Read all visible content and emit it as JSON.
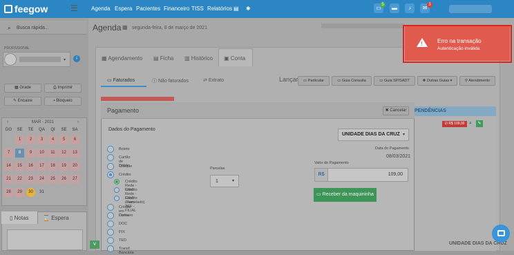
{
  "header": {
    "brand": "feegow",
    "nav": [
      "Agenda",
      "Espera",
      "Pacientes",
      "Financeiro",
      "TISS",
      "Relatórios"
    ],
    "badges": {
      "first": "5",
      "last": "3"
    }
  },
  "sidebar": {
    "search_placeholder": "Busca rápida...",
    "professional_label": "PROFISSIONAL",
    "buttons": [
      "Grade",
      "Imprimir",
      "Encaixe",
      "Bloqueio"
    ],
    "calendar": {
      "month": "MAR - 2021",
      "weekdays": [
        "DO",
        "SE",
        "TE",
        "QA",
        "QI",
        "SE",
        "SA"
      ],
      "days": [
        [
          "",
          "1",
          "2",
          "3",
          "4",
          "5",
          "6"
        ],
        [
          "7",
          "8",
          "9",
          "10",
          "11",
          "12",
          "13"
        ],
        [
          "14",
          "15",
          "16",
          "17",
          "18",
          "19",
          "20"
        ],
        [
          "21",
          "22",
          "23",
          "24",
          "25",
          "26",
          "27"
        ],
        [
          "28",
          "29",
          "30",
          "31",
          "",
          "",
          ""
        ]
      ]
    },
    "notes_tabs": [
      "Notas",
      "Espera"
    ]
  },
  "breadcrumb": {
    "title": "Agenda",
    "date": "segunda-feira, 8 de março de 2021"
  },
  "tabs": [
    "Agendamento",
    "Ficha",
    "Histórico",
    "Conta"
  ],
  "subtabs": [
    "Faturados",
    "Não faturados",
    "Extrato"
  ],
  "launch": {
    "label": "Lançar",
    "buttons": [
      "Particular",
      "Guia Consulta",
      "Guia SP/SADT",
      "Outras Guias",
      "Atendimento"
    ]
  },
  "right_panel": {
    "header": "PENDÊNCIAS",
    "amount_tag": "R$ 109,00",
    "footer": "UNIDADE DIAS DA CRUZ"
  },
  "modal": {
    "title": "Pagamento",
    "cancel": "Cancelar",
    "section": "Dados do Pagamento",
    "unit": "UNIDADE DIAS DA CRUZ",
    "methods": [
      "Boleto",
      "Cartão de Débito",
      "Cheque",
      "Crédito",
      "Crédito em Conta",
      "Dinheiro",
      "DOC",
      "PIX",
      "TED",
      "Transf. Bancária"
    ],
    "credit_options": [
      "Crédito Rede - Filial",
      "Crédito Rede - Filial (Parcelado)",
      "Crédito - sem TEF - FILIAL"
    ],
    "installments_label": "Parcelas",
    "installments_value": "1",
    "date_label": "Data do Pagamento",
    "date_value": "08/03/2021",
    "value_label": "Valor do Pagamento",
    "currency": "R$",
    "value": "109,00",
    "receive_button": "Receber da maquininha"
  },
  "toast": {
    "title": "Erro na transação",
    "message": "Autenticação inválida"
  }
}
